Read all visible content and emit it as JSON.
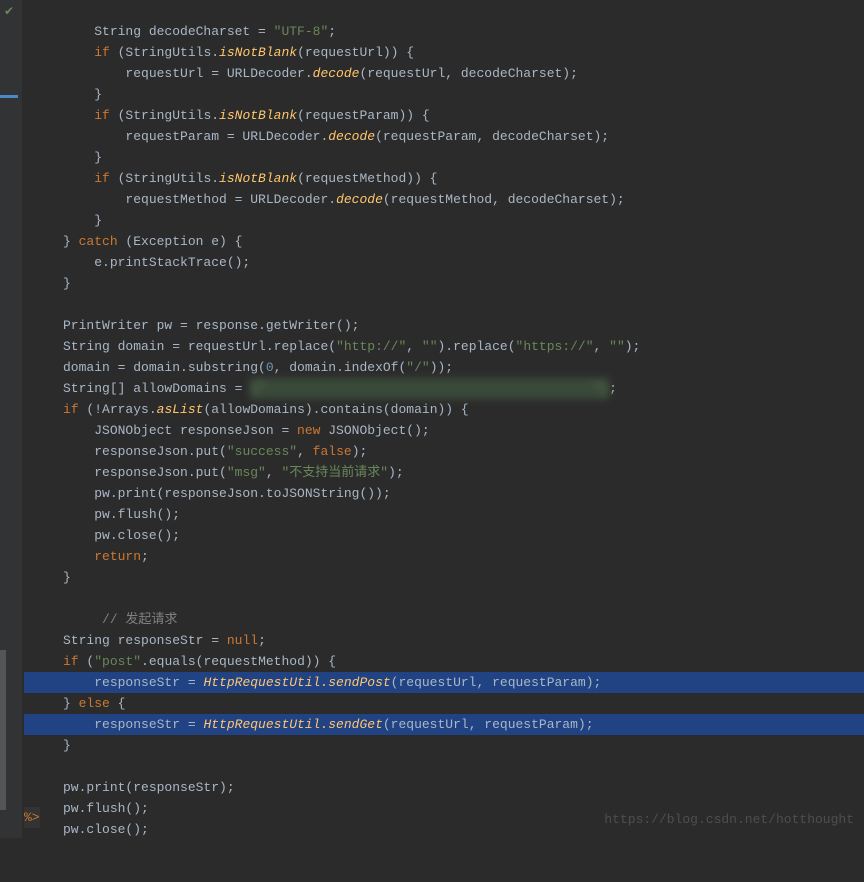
{
  "code": {
    "l1": "         String decodeCharset = \"UTF-8\";",
    "l2_if": "         if",
    "l2_rest": " (StringUtils.",
    "isNotBlank": "isNotBlank",
    "l2_end": "(requestUrl)) {",
    "l3_a": "             requestUrl = URLDecoder.",
    "decode": "decode",
    "l3_b": "(requestUrl, decodeCharset);",
    "l4": "         }",
    "l5_end": "(requestParam)) {",
    "l6_a": "             requestParam = URLDecoder.",
    "l6_b": "(requestParam, decodeCharset);",
    "l7": "         }",
    "l8_end": "(requestMethod)) {",
    "l9_a": "             requestMethod = URLDecoder.",
    "l9_b": "(requestMethod, decodeCharset);",
    "l10": "         }",
    "l11_a": "     } ",
    "catch": "catch",
    "l11_b": " (Exception e) {",
    "l12": "         e.printStackTrace();",
    "l13": "     }",
    "l15": "     PrintWriter pw = response.getWriter();",
    "l16_a": "     String domain = requestUrl.replace(",
    "l16_http": "\"http://\"",
    "l16_b": ", ",
    "l16_empty": "\"\"",
    "l16_c": ").replace(",
    "l16_https": "\"https://\"",
    "l16_d": ", ",
    "l16_e": ");",
    "l17_a": "     domain = domain.substring(",
    "l17_zero": "0",
    "l17_b": ", domain.indexOf(",
    "l17_slash": "\"/\"",
    "l17_c": "));",
    "l18_a": "     String[] allowDomains = ",
    "l18_blur": "{\"                                              \"};",
    "l19_a": "     ",
    "if": "if",
    "l19_b": " (!Arrays.",
    "asList": "asList",
    "l19_c": "(allowDomains).contains(domain)) {",
    "l20_a": "         JSONObject responseJson = ",
    "new": "new",
    "l20_b": " JSONObject();",
    "l21_a": "         responseJson.put(",
    "l21_success": "\"success\"",
    "l21_b": ", ",
    "false": "false",
    "l21_c": ");",
    "l22_a": "         responseJson.put(",
    "l22_msg": "\"msg\"",
    "l22_b": ", ",
    "l22_text": "\"不支持当前请求\"",
    "l22_c": ");",
    "l23": "         pw.print(responseJson.toJSONString());",
    "l24": "         pw.flush();",
    "l25": "         pw.close();",
    "l26_a": "         ",
    "return": "return",
    "l26_b": ";",
    "l27": "     }",
    "l29": "     // 发起请求",
    "l30_a": "     String responseStr = ",
    "null": "null",
    "l30_b": ";",
    "l31_a": "     ",
    "l31_b": " (",
    "l31_post": "\"post\"",
    "l31_c": ".equals(requestMethod)) {",
    "l32_a": "         responseStr = ",
    "l32_call": "HttpRequestUtil.sendPost",
    "l32_b": "(requestUrl, requestParam);",
    "l33_a": "     } ",
    "else": "else",
    "l33_b": " {",
    "l34_a": "         responseStr = ",
    "l34_call": "HttpRequestUtil.sendGet",
    "l34_b": "(requestUrl, requestParam);",
    "l35": "     }",
    "l37": "     pw.print(responseStr);",
    "l38": "     pw.flush();",
    "l39": "     pw.close();",
    "jsp": "%>"
  },
  "watermark": "https://blog.csdn.net/hotthought"
}
